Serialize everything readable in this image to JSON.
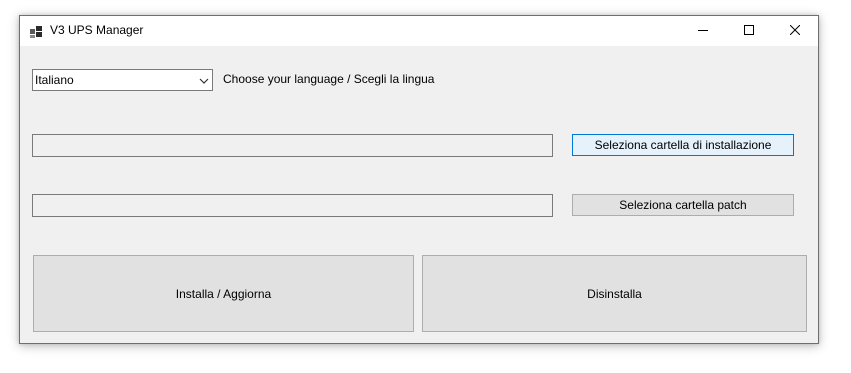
{
  "window": {
    "title": "V3 UPS Manager",
    "icon": "app-icon",
    "controls": {
      "minimize_icon": "minimize-icon",
      "maximize_icon": "maximize-icon",
      "close_icon": "close-icon"
    }
  },
  "language": {
    "selected": "Italiano",
    "label": "Choose your language / Scegli la lingua"
  },
  "install_folder": {
    "value": "",
    "button_label": "Seleziona cartella di installazione"
  },
  "patch_folder": {
    "value": "",
    "button_label": "Seleziona cartella patch"
  },
  "actions": {
    "install_label": "Installa / Aggiorna",
    "uninstall_label": "Disinstalla"
  },
  "colors": {
    "window_background": "#f0f0f0",
    "titlebar_background": "#ffffff",
    "focus_accent": "#0078d7",
    "focus_fill": "#e5f1fb",
    "button_fill": "#e1e1e1"
  }
}
